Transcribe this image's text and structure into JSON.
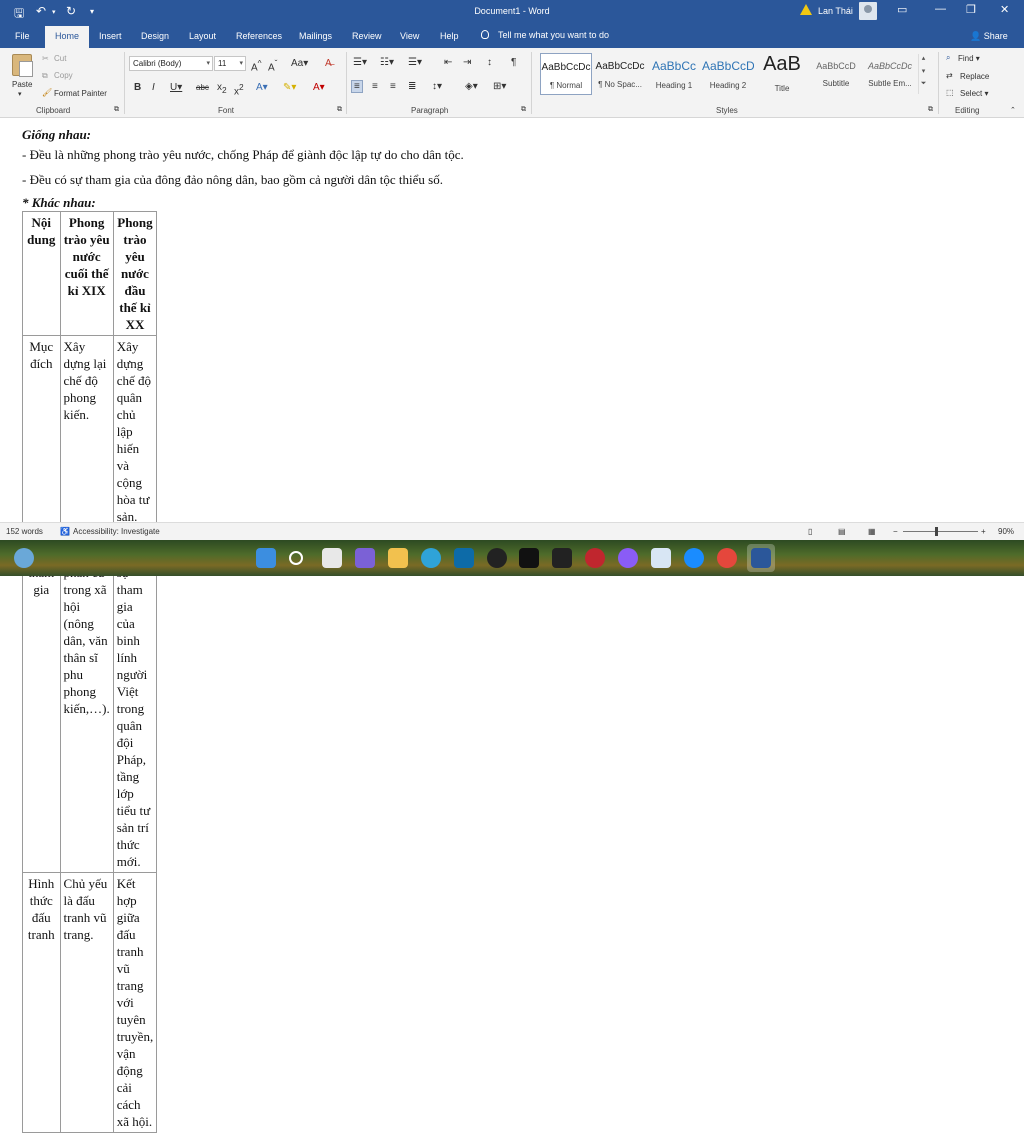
{
  "titlebar": {
    "title": "Document1  -  Word",
    "user": "Lan Thái"
  },
  "tabs": [
    "File",
    "Home",
    "Insert",
    "Design",
    "Layout",
    "References",
    "Mailings",
    "Review",
    "View",
    "Help"
  ],
  "tellme": "Tell me what you want to do",
  "share": "Share",
  "clipboard": {
    "paste": "Paste",
    "cut": "Cut",
    "copy": "Copy",
    "format_painter": "Format Painter",
    "label": "Clipboard"
  },
  "font": {
    "name": "Calibri (Body)",
    "size": "11",
    "label": "Font"
  },
  "paragraph": {
    "label": "Paragraph"
  },
  "styles": {
    "items": [
      {
        "preview": "AaBbCcDc",
        "name": "¶ Normal"
      },
      {
        "preview": "AaBbCcDc",
        "name": "¶ No Spac..."
      },
      {
        "preview": "AaBbCc",
        "name": "Heading 1"
      },
      {
        "preview": "AaBbCcD",
        "name": "Heading 2"
      },
      {
        "preview": "AaB",
        "name": "Title"
      },
      {
        "preview": "AaBbCcD",
        "name": "Subtitle"
      },
      {
        "preview": "AaBbCcDc",
        "name": "Subtle Em..."
      }
    ],
    "label": "Styles"
  },
  "editing": {
    "find": "Find",
    "replace": "Replace",
    "select": "Select",
    "label": "Editing"
  },
  "document": {
    "heading1": "Giống nhau:",
    "line1": "- Đều là những phong trào yêu nước, chống Pháp để giành độc lập tự do cho dân tộc.",
    "line2": "- Đều có sự tham gia của đông đảo nông dân, bao gồm cả người dân tộc thiểu số.",
    "heading2": "* Khác nhau:",
    "table": {
      "headers": [
        "Nội dung",
        "Phong trào yêu nước cuối thế kỉ XIX",
        "Phong trào yêu nước đầu thế kỉ XX"
      ],
      "rows": [
        [
          "Mục đích",
          "Xây dựng lại chế độ phong kiến.",
          "Xây dựng chế độ quân chủ lập hiến và cộng hòa tư sản."
        ],
        [
          "Lực lượng tham gia",
          "Các thành phần cũ trong xã hội (nông dân, văn thân sĩ phu phong kiến,…).",
          "Đã có thêm sự tham gia của binh lính người Việt trong quân đội Pháp, tầng lớp tiểu tư sản trí thức mới."
        ],
        [
          "Hình thức đấu tranh",
          "Chủ yếu là đấu tranh vũ trang.",
          "Kết hợp giữa đấu tranh vũ trang với tuyên truyền, vận động cải cách xã hội."
        ]
      ]
    }
  },
  "status": {
    "words": "152 words",
    "accessibility": "Accessibility: Investigate",
    "zoom": "90%"
  },
  "colors": {
    "word_blue": "#2b579a",
    "ribbon_bg": "#f3f3f3"
  }
}
